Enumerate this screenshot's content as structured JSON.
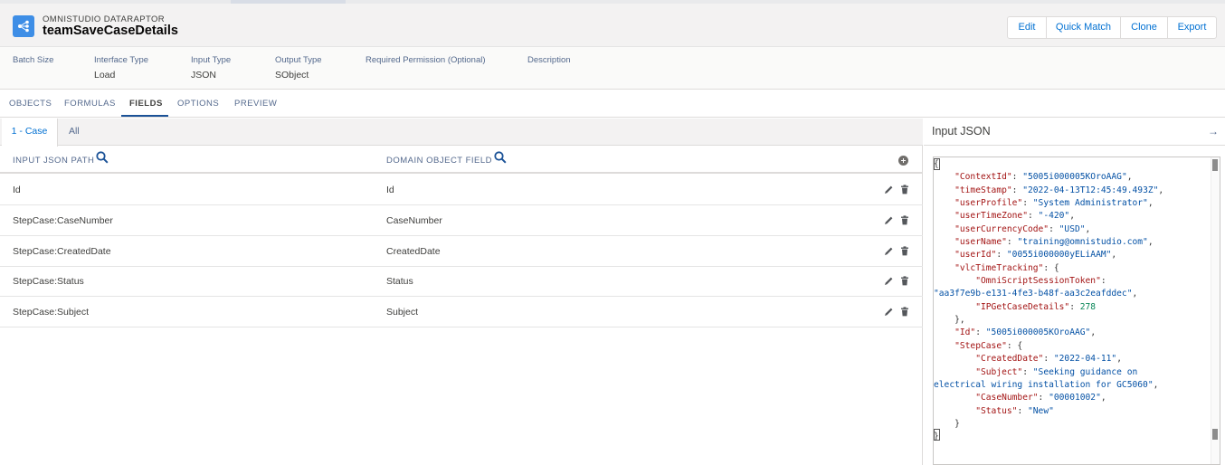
{
  "header": {
    "eyebrow": "OMNISTUDIO DATARAPTOR",
    "title": "teamSaveCaseDetails",
    "icon": "dataraptor-icon",
    "buttons": {
      "edit": "Edit",
      "quick_match": "Quick Match",
      "clone": "Clone",
      "export": "Export"
    }
  },
  "meta": {
    "batch_size": {
      "label": "Batch Size",
      "value": ""
    },
    "interface_type": {
      "label": "Interface Type",
      "value": "Load"
    },
    "input_type": {
      "label": "Input Type",
      "value": "JSON"
    },
    "output_type": {
      "label": "Output Type",
      "value": "SObject"
    },
    "required_permission": {
      "label": "Required Permission (Optional)",
      "value": ""
    },
    "description": {
      "label": "Description",
      "value": ""
    }
  },
  "tabs": [
    "OBJECTS",
    "FORMULAS",
    "FIELDS",
    "OPTIONS",
    "PREVIEW"
  ],
  "active_tab": "FIELDS",
  "subtabs": {
    "active": "1 - Case",
    "other": "All"
  },
  "columns": {
    "input_path": "INPUT JSON PATH",
    "domain_field": "DOMAIN OBJECT FIELD"
  },
  "rows": [
    {
      "input": "Id",
      "field": "Id"
    },
    {
      "input": "StepCase:CaseNumber",
      "field": "CaseNumber"
    },
    {
      "input": "StepCase:CreatedDate",
      "field": "CreatedDate"
    },
    {
      "input": "StepCase:Status",
      "field": "Status"
    },
    {
      "input": "StepCase:Subject",
      "field": "Subject"
    }
  ],
  "input_json_panel": {
    "title": "Input JSON",
    "lines": [
      "{",
      "    \"ContextId\": \"5005i000005KOroAAG\",",
      "    \"timeStamp\": \"2022-04-13T12:45:49.493Z\",",
      "    \"userProfile\": \"System Administrator\",",
      "    \"userTimeZone\": \"-420\",",
      "    \"userCurrencyCode\": \"USD\",",
      "    \"userName\": \"training@omnistudio.com\",",
      "    \"userId\": \"0055i000000yELiAAM\",",
      "    \"vlcTimeTracking\": {",
      "        \"OmniScriptSessionToken\":",
      "\"aa3f7e9b-e131-4fe3-b48f-aa3c2eafddec\",",
      "        \"IPGetCaseDetails\": 278",
      "    },",
      "    \"Id\": \"5005i000005KOroAAG\",",
      "    \"StepCase\": {",
      "        \"CreatedDate\": \"2022-04-11\",",
      "        \"Subject\": \"Seeking guidance on",
      "electrical wiring installation for GC5060\",",
      "        \"CaseNumber\": \"00001002\",",
      "        \"Status\": \"New\"",
      "    }",
      "}"
    ]
  },
  "colors": {
    "accent": "#0070d2",
    "icon_bg": "#3e8ee6",
    "tab_underline": "#1b5297"
  }
}
